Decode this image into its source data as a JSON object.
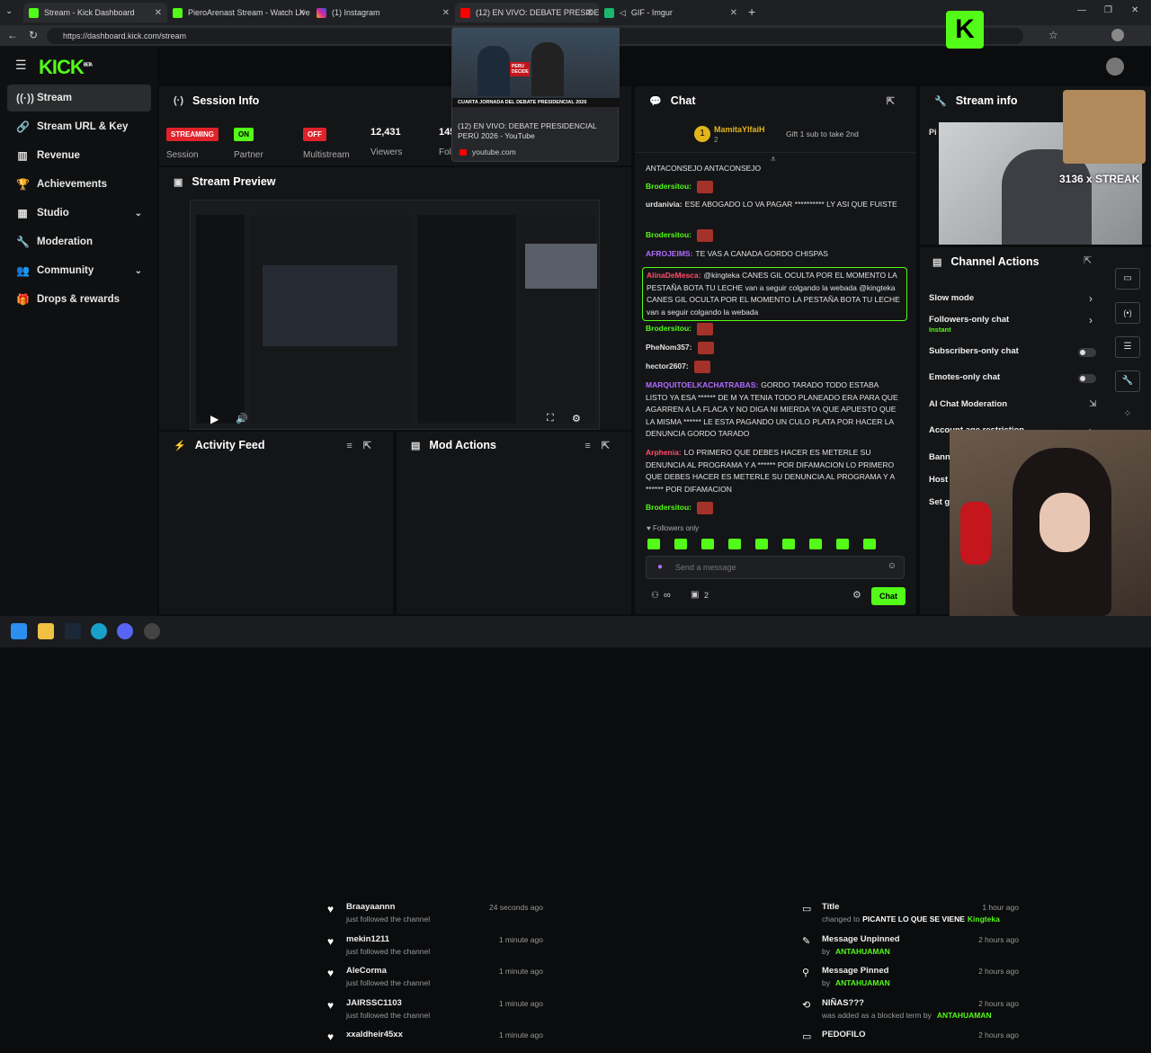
{
  "browser": {
    "tabs": [
      {
        "label": "Stream - Kick Dashboard",
        "active": true
      },
      {
        "label": "PieroArenast Stream - Watch Live",
        "active": false
      },
      {
        "label": "(1) Instagram",
        "active": false
      },
      {
        "label": "(12) EN VIVO: DEBATE PRESIDENC",
        "active": false
      },
      {
        "label": "GIF - Imgur",
        "active": false
      }
    ],
    "url": "https://dashboard.kick.com/stream",
    "tooltip": {
      "title": "(12) EN VIVO: DEBATE PRESIDENCIAL PERÚ 2026 - YouTube",
      "caption": "CUARTA JORNADA DEL DEBATE PRESIDENCIAL 2026",
      "domain": "youtube.com",
      "thumb_badge": "PERU DECIDE"
    }
  },
  "sidebar": {
    "logo": "KICK",
    "logo_sup": "BETA",
    "items": [
      {
        "label": "Stream",
        "icon": "broadcast-icon"
      },
      {
        "label": "Stream URL & Key",
        "icon": "link-icon"
      },
      {
        "label": "Revenue",
        "icon": "chart-icon"
      },
      {
        "label": "Achievements",
        "icon": "trophy-icon"
      },
      {
        "label": "Studio",
        "icon": "studio-icon"
      },
      {
        "label": "Moderation",
        "icon": "wrench-icon"
      },
      {
        "label": "Community",
        "icon": "users-icon"
      },
      {
        "label": "Drops & rewards",
        "icon": "gift-icon"
      }
    ]
  },
  "session": {
    "title": "Session Info",
    "status": "STREAMING",
    "status_label": "Session",
    "partner": "ON",
    "partner_label": "Partner",
    "multistream": "OFF",
    "multistream_label": "Multistream",
    "viewers": "12,431",
    "viewers_label": "Viewers",
    "followers_partial": "145",
    "followers_label": "Fol"
  },
  "preview": {
    "title": "Stream Preview"
  },
  "activity": {
    "title": "Activity Feed",
    "items": [
      {
        "name": "Braayaannn",
        "sub": "just followed the channel",
        "time": "24 seconds ago"
      },
      {
        "name": "mekin1211",
        "sub": "just followed the channel",
        "time": "1 minute ago"
      },
      {
        "name": "AleCorma",
        "sub": "just followed the channel",
        "time": "1 minute ago"
      },
      {
        "name": "JAIRSSC1103",
        "sub": "just followed the channel",
        "time": "1 minute ago"
      },
      {
        "name": "xxaldheir45xx",
        "sub": "",
        "time": "1 minute ago"
      }
    ]
  },
  "modactions": {
    "title": "Mod Actions",
    "items": [
      {
        "title": "Title",
        "sub": "changed to",
        "value": "PICANTE LO QUE SE VIENE",
        "by": "Kingteka",
        "time": "1 hour ago"
      },
      {
        "title": "Message Unpinned",
        "sub": "by",
        "value": "",
        "by": "ANTAHUAMAN",
        "time": "2 hours ago"
      },
      {
        "title": "Message Pinned",
        "sub": "by",
        "value": "",
        "by": "ANTAHUAMAN",
        "time": "2 hours ago"
      },
      {
        "title": "NIÑAS???",
        "sub": "was added as a blocked term by",
        "value": "",
        "by": "ANTAHUAMAN",
        "time": "2 hours ago"
      },
      {
        "title": "PEDOFILO",
        "sub": "",
        "value": "",
        "by": "",
        "time": "2 hours ago"
      }
    ]
  },
  "chat": {
    "title": "Chat",
    "gift_user": "MamitaYlfaiH",
    "gift_count": "2",
    "gift_text": "Gift 1 sub to take 2nd",
    "lines": [
      {
        "user": "",
        "color": "#e2e2e2",
        "text": "ANTACONSEJO ANTACONSEJO",
        "emote": false
      },
      {
        "user": "Brodersitou:",
        "color": "#53fc18",
        "text": "",
        "emote": true
      },
      {
        "user": "urdanivia:",
        "color": "#e2e2e2",
        "text": "ESE ABOGADO LO VA PAGAR ********** LY ASI QUE FUISTE",
        "emote": false
      },
      {
        "user": "Brodersitou:",
        "color": "#53fc18",
        "text": "",
        "emote": true
      },
      {
        "user": "AFROJEIMS:",
        "color": "#b06cff",
        "text": "TE VAS A CANADA GORDO CHISPAS",
        "emote": false
      },
      {
        "user": "AlinaDeMesca:",
        "color": "#ff4d6d",
        "text": "@kingteka CANES GIL OCULTA POR EL MOMENTO LA PESTAÑA BOTA TU LECHE van a seguir colgando la webada @kingteka CANES GIL OCULTA POR EL MOMENTO LA PESTAÑA BOTA TU LECHE van a seguir colgando la webada",
        "emote": false
      },
      {
        "user": "Brodersitou:",
        "color": "#53fc18",
        "text": "",
        "emote": true
      },
      {
        "user": "PheNom357:",
        "color": "#e2e2e2",
        "text": "",
        "emote": true
      },
      {
        "user": "hector2607:",
        "color": "#e2e2e2",
        "text": "",
        "emote": true
      },
      {
        "user": "MARQUITOELKACHATRABAS:",
        "color": "#b06cff",
        "text": "GORDO TARADO TODO ESTABA LISTO YA ESA ****** DE M YA TENIA TODO PLANEADO ERA PARA QUE AGARREN A LA FLACA Y NO DIGA NI MIERDA YA QUE APUESTO QUE LA MISMA ****** LE ESTA PAGANDO UN CULO PLATA POR HACER LA DENUNCIA GORDO TARADO",
        "emote": false
      },
      {
        "user": "Arphenia:",
        "color": "#ff4d6d",
        "text": "LO PRIMERO QUE DEBES HACER ES METERLE SU DENUNCIA AL PROGRAMA Y A ****** POR DIFAMACION LO PRIMERO QUE DEBES HACER ES METERLE SU DENUNCIA AL PROGRAMA Y A ****** POR DIFAMACION",
        "emote": false
      },
      {
        "user": "Brodersitou:",
        "color": "#53fc18",
        "text": "",
        "emote": true
      }
    ],
    "mode": "Followers only",
    "placeholder": "Send a message",
    "viewers_small": "∞",
    "mod_count": "2",
    "send_label": "Chat"
  },
  "streaminfo": {
    "title": "Stream info",
    "partial": "Pi"
  },
  "overlay": {
    "streak": "3136 x STREAK"
  },
  "channel_actions": {
    "title": "Channel Actions",
    "items": [
      {
        "label": "Slow mode",
        "sub": "",
        "control": "chevron"
      },
      {
        "label": "Followers-only chat",
        "sub": "Instant",
        "control": "chevron"
      },
      {
        "label": "Subscribers-only chat",
        "sub": "",
        "control": "toggle"
      },
      {
        "label": "Emotes-only chat",
        "sub": "",
        "control": "toggle"
      },
      {
        "label": "AI Chat Moderation",
        "sub": "",
        "control": "external"
      },
      {
        "label": "Account age restriction",
        "sub": "",
        "control": "chevron"
      },
      {
        "label": "Bann",
        "sub": "",
        "control": "none"
      },
      {
        "label": "Host",
        "sub": "",
        "control": "none"
      },
      {
        "label": "Set g",
        "sub": "",
        "control": "none"
      }
    ]
  },
  "colors": {
    "accent": "#53fc18",
    "streaming": "#e0222a",
    "off": "#e0222a",
    "panel": "#141517"
  }
}
